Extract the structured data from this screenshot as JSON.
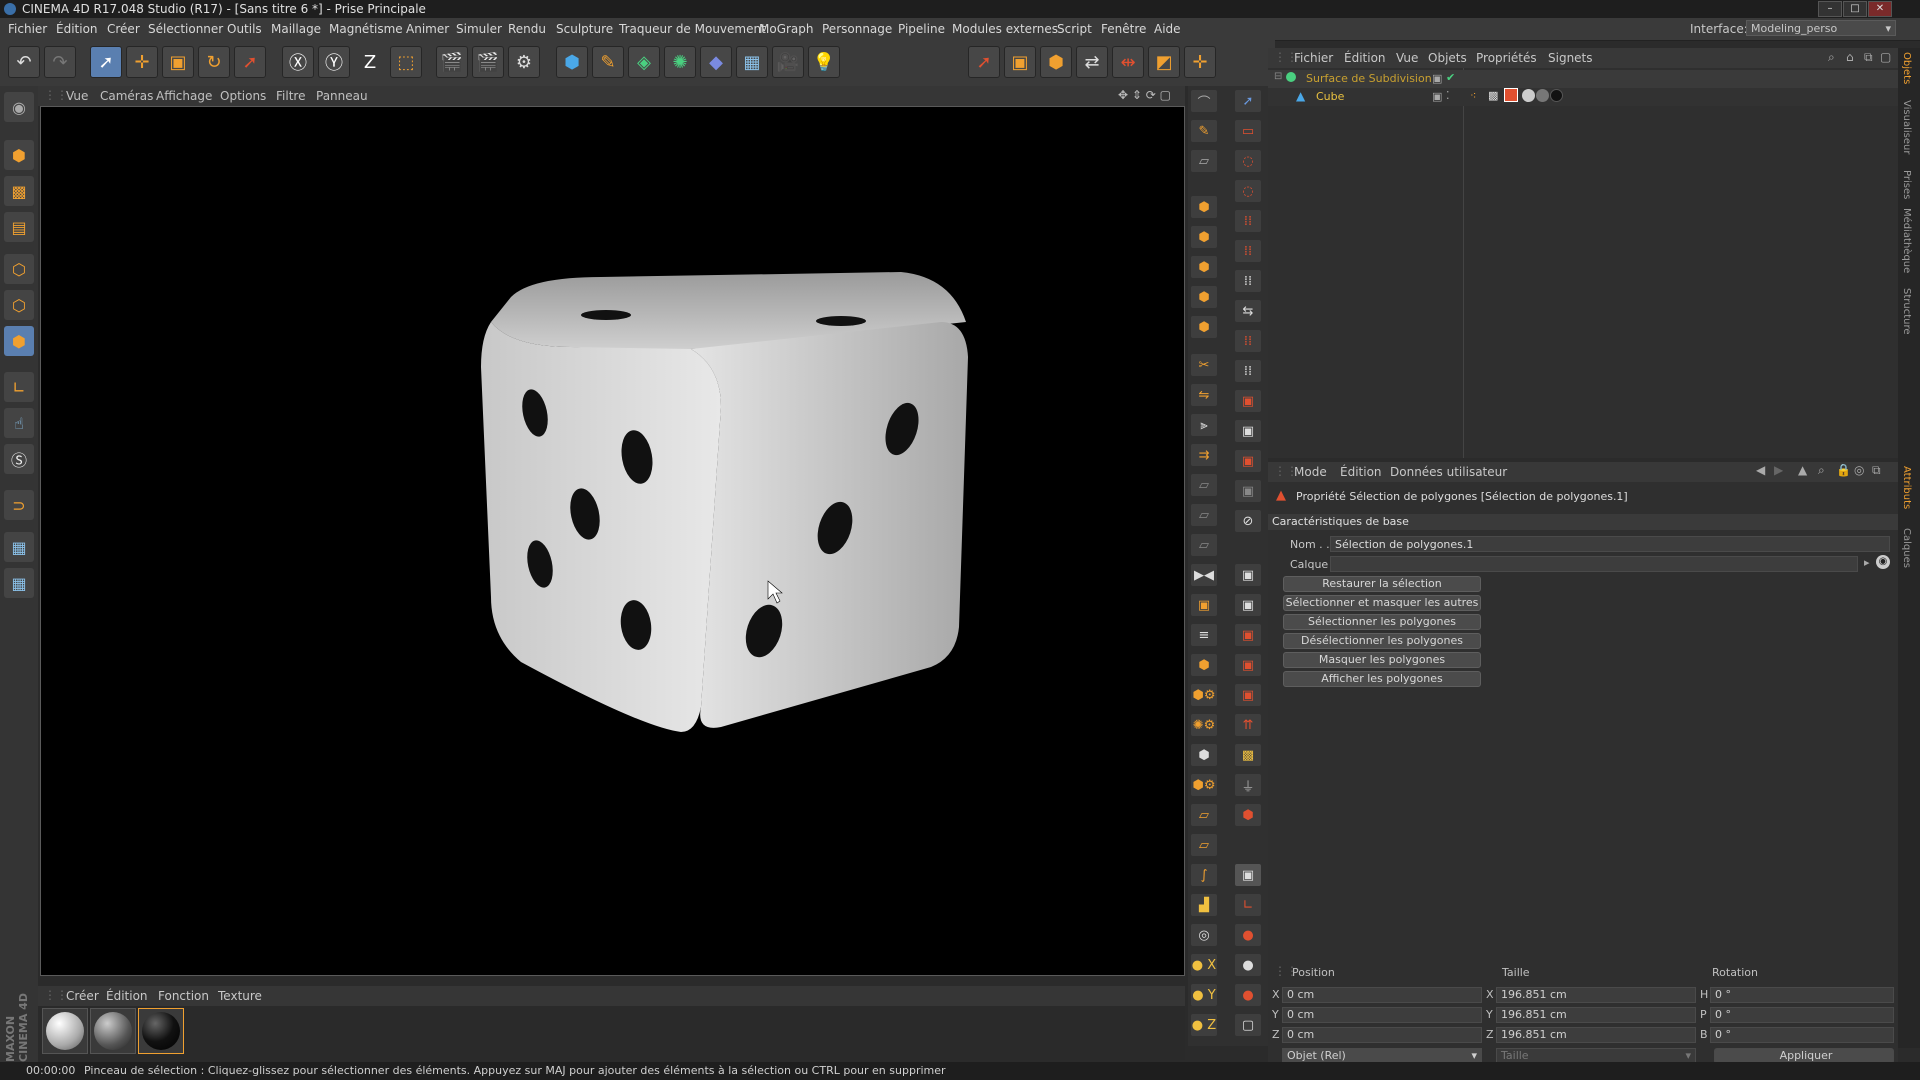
{
  "window": {
    "title": "CINEMA 4D R17.048 Studio (R17) - [Sans titre 6 *] - Prise Principale",
    "controls": [
      "–",
      "□",
      "✕"
    ]
  },
  "menubar": {
    "items": [
      "Fichier",
      "Édition",
      "Créer",
      "Sélectionner",
      "Outils",
      "Maillage",
      "Magnétisme",
      "Animer",
      "Simuler",
      "Rendu",
      "Sculpture",
      "Traqueur de Mouvement",
      "MoGraph",
      "Personnage",
      "Pipeline",
      "Modules externes",
      "Script",
      "Fenêtre",
      "Aide"
    ],
    "interface_label": "Interface:",
    "interface_value": "Modeling_perso"
  },
  "viewport": {
    "menu": [
      "Vue",
      "Caméras",
      "Affichage",
      "Options",
      "Filtre",
      "Panneau"
    ]
  },
  "object_manager": {
    "menu": [
      "Fichier",
      "Édition",
      "Vue",
      "Objets",
      "Propriétés",
      "Signets"
    ],
    "objects": [
      {
        "name": "Surface de Subdivision",
        "color": "#c8a030"
      },
      {
        "name": "Cube",
        "color": "#e8c040"
      }
    ]
  },
  "attribute_manager": {
    "menu": [
      "Mode",
      "Édition",
      "Données utilisateur"
    ],
    "header": "Propriété Sélection de polygones [Sélection de polygones.1]",
    "section": "Caractéristiques de base",
    "name_label": "Nom . .",
    "name_value": "Sélection de polygones.1",
    "layer_label": "Calque",
    "buttons": [
      "Restaurer la sélection",
      "Sélectionner et masquer les autres",
      "Sélectionner les polygones",
      "Désélectionner les polygones",
      "Masquer les polygones",
      "Afficher les polygones"
    ]
  },
  "coordinates": {
    "headers": [
      "Position",
      "Taille",
      "Rotation"
    ],
    "rows": [
      {
        "a": "X",
        "pos": "0 cm",
        "b": "X",
        "size": "196.851 cm",
        "c": "H",
        "rot": "0 °"
      },
      {
        "a": "Y",
        "pos": "0 cm",
        "b": "Y",
        "size": "196.851 cm",
        "c": "P",
        "rot": "0 °"
      },
      {
        "a": "Z",
        "pos": "0 cm",
        "b": "Z",
        "size": "196.851 cm",
        "c": "B",
        "rot": "0 °"
      }
    ],
    "mode": "Objet (Rel)",
    "size_mode": "Taille",
    "apply": "Appliquer"
  },
  "material_manager": {
    "menu": [
      "Créer",
      "Édition",
      "Fonction",
      "Texture"
    ]
  },
  "right_tabs": [
    "Objets",
    "Visualiseur",
    "Prises",
    "Médiathèque",
    "Structure",
    "Attributs",
    "Calques"
  ],
  "branding": "MAXON CINEMA 4D",
  "status": {
    "time": "00:00:00",
    "message": "Pinceau de sélection : Cliquez-glissez pour sélectionner des éléments. Appuyez sur MAJ pour ajouter des éléments à la sélection ou CTRL pour en supprimer"
  }
}
